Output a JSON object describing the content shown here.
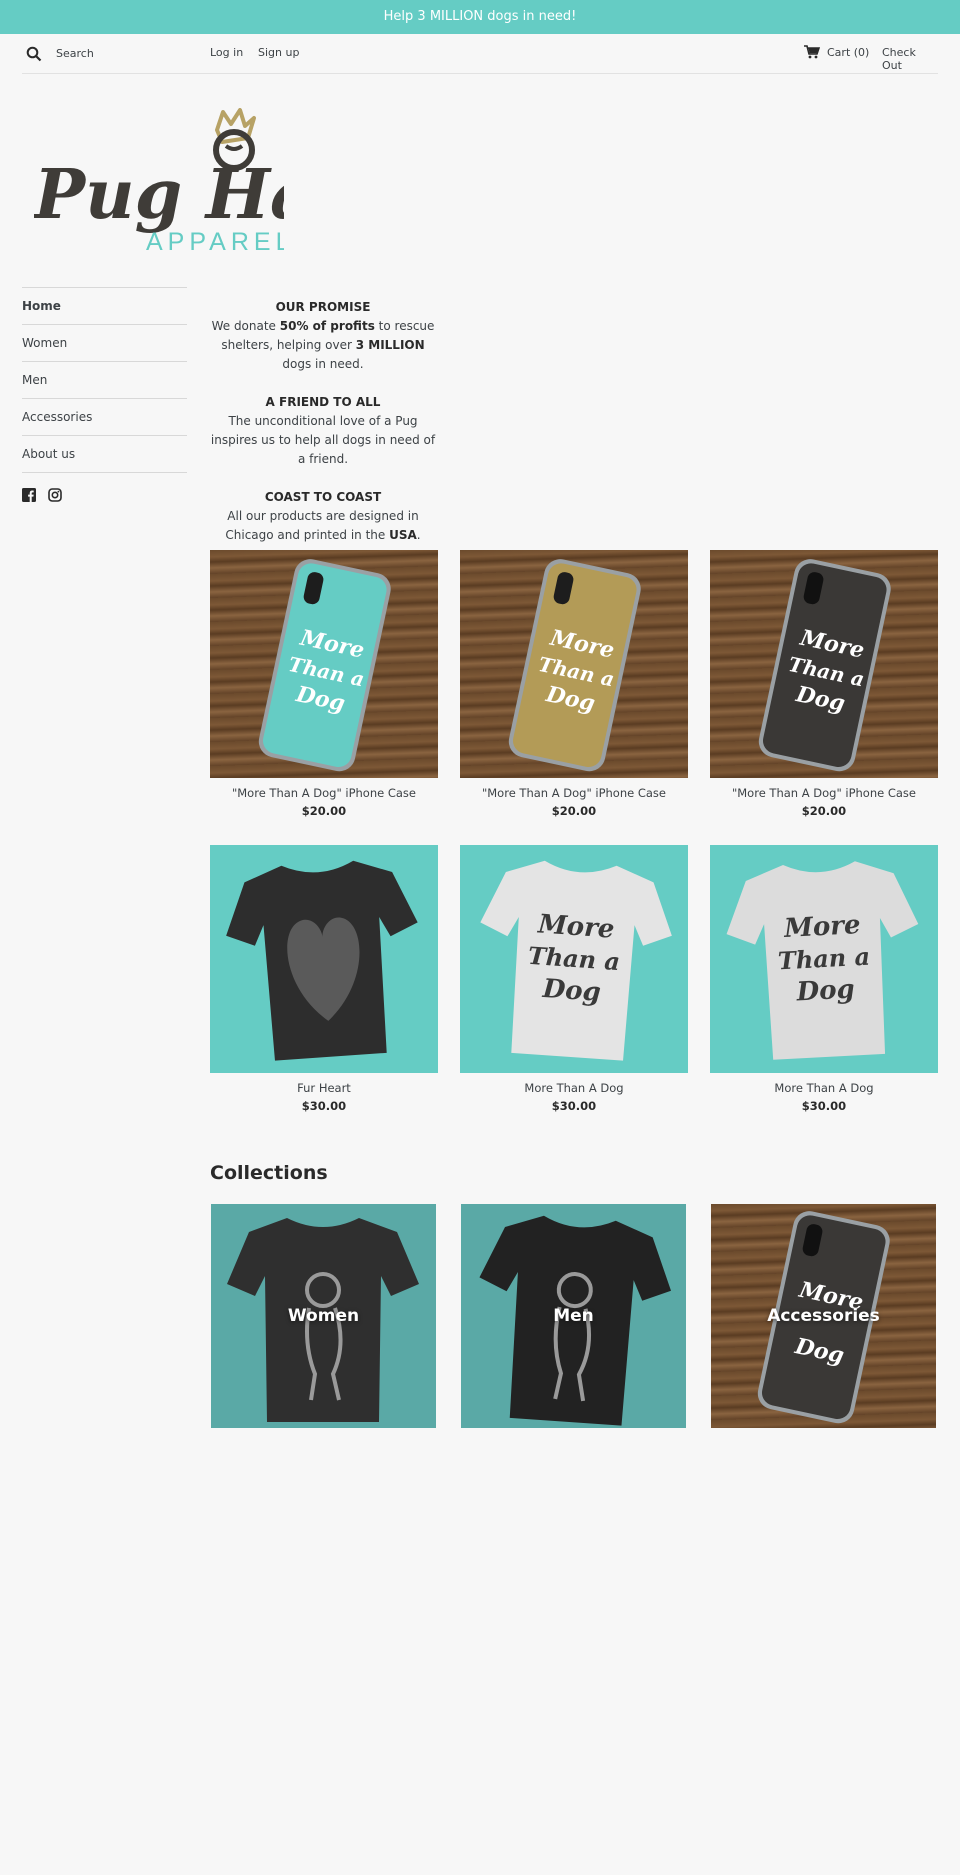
{
  "announcement": "Help 3 MILLION dogs in need!",
  "header": {
    "search_placeholder": "Search",
    "login": "Log in",
    "signup": "Sign up",
    "cart": "Cart (0)",
    "checkout": "Check Out"
  },
  "logo": {
    "brand": "Pug Haus",
    "sub": "APPAREL"
  },
  "nav": {
    "items": [
      {
        "label": "Home"
      },
      {
        "label": "Women"
      },
      {
        "label": "Men"
      },
      {
        "label": "Accessories"
      },
      {
        "label": "About us"
      }
    ]
  },
  "social": [
    "facebook-icon",
    "instagram-icon"
  ],
  "promise": {
    "h1": "OUR PROMISE",
    "p1_a": "We donate ",
    "p1_b": "50% of profits",
    "p1_c": " to rescue shelters, helping over ",
    "p1_d": "3 MILLION",
    "p1_e": " dogs in need.",
    "h2": "A FRIEND TO ALL",
    "p2": "The unconditional love of a Pug inspires us to help all dogs in need of a friend.",
    "h3": "COAST TO COAST",
    "p3_a": "All our products are designed in Chicago and printed in the ",
    "p3_b": "USA",
    "p3_c": "."
  },
  "products": [
    {
      "title": "\"More Than A Dog\" iPhone Case",
      "price": "$20.00",
      "case_color": "#65ccc4"
    },
    {
      "title": "\"More Than A Dog\" iPhone Case",
      "price": "$20.00",
      "case_color": "#b39b57"
    },
    {
      "title": "\"More Than A Dog\" iPhone Case",
      "price": "$20.00",
      "case_color": "#3a3836"
    },
    {
      "title": "Fur Heart",
      "price": "$30.00"
    },
    {
      "title": "More Than A Dog",
      "price": "$30.00"
    },
    {
      "title": "More Than A Dog",
      "price": "$30.00"
    }
  ],
  "collections": {
    "title": "Collections",
    "items": [
      {
        "label": "Women"
      },
      {
        "label": "Men"
      },
      {
        "label": "Accessories"
      }
    ]
  },
  "colors": {
    "accent": "#65ccc4",
    "text": "#3d4246",
    "background": "#f7f7f7"
  }
}
